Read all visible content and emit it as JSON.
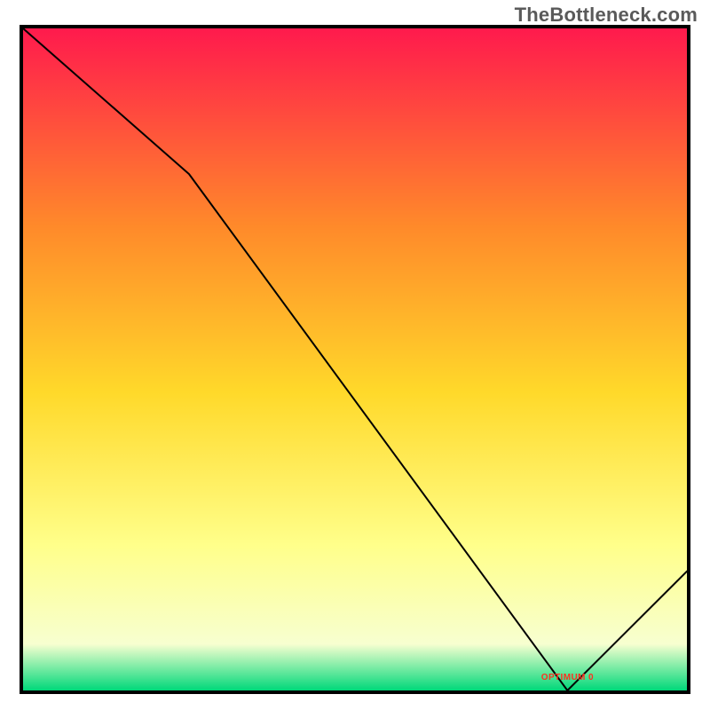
{
  "watermark": "TheBottleneck.com",
  "optimum_label": "OPTIMUM 0",
  "colors": {
    "top": "#ff1a4d",
    "mid_upper": "#ff8a2a",
    "mid": "#ffd92a",
    "mid_lower": "#ffff8a",
    "near_bottom": "#f7ffd0",
    "bottom": "#00d87a",
    "curve": "#000000",
    "frame": "#000000",
    "label": "#ff3020"
  },
  "chart_data": {
    "type": "line",
    "title": "",
    "xlabel": "",
    "ylabel": "",
    "xlim": [
      0,
      100
    ],
    "ylim": [
      0,
      100
    ],
    "x": [
      0,
      25,
      82,
      100
    ],
    "values": [
      100,
      78,
      0,
      18
    ],
    "optimum_x": 82,
    "optimum_y": 0,
    "notes": "Piecewise-linear bottleneck curve over vertical heat gradient. Values are percent-of-plot estimates read from the image; no numeric axes are shown."
  }
}
